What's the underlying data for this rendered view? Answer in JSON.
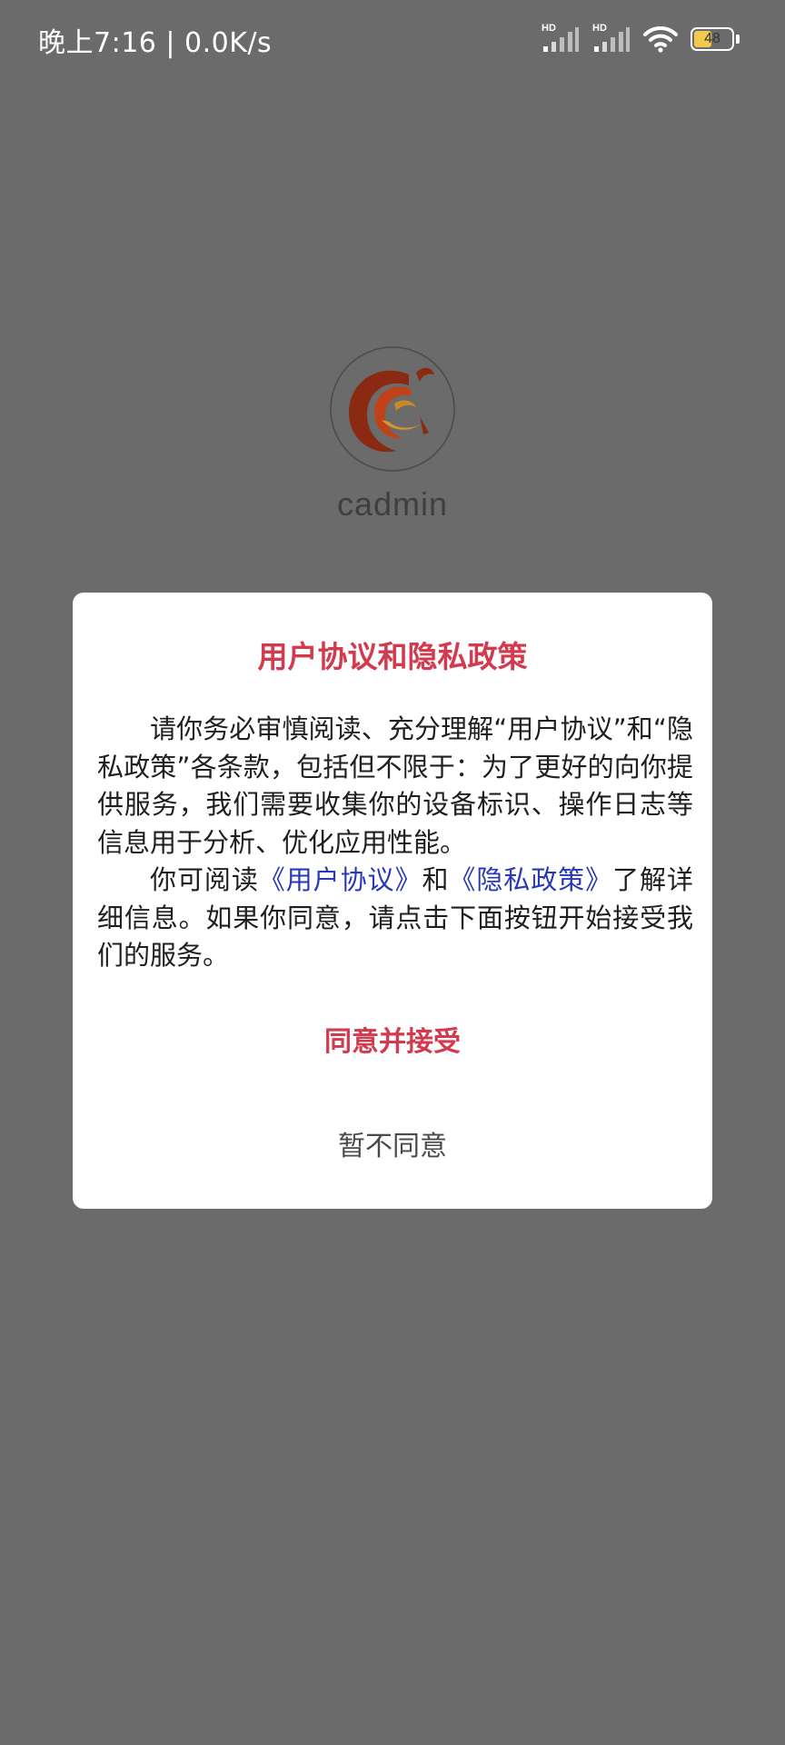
{
  "status_bar": {
    "time": "晚上7:16 | 0.0K/s",
    "sim1_label": "HD",
    "sim2_label": "HD",
    "battery_level": "48",
    "battery_fraction": 0.48,
    "icons": [
      "signal-icon",
      "signal-icon",
      "wifi-icon",
      "battery-icon"
    ]
  },
  "app": {
    "name": "cadmin",
    "logo_icon": "cadmin-logo"
  },
  "dialog": {
    "title": "用户协议和隐私政策",
    "paragraph1": "请你务必审慎阅读、充分理解“用户协议”和“隐私政策”各条款，包括但不限于：为了更好的向你提供服务，我们需要收集你的设备标识、操作日志等信息用于分析、优化应用性能。",
    "p2_prefix": "你可阅读",
    "link_user_agreement": "《用户协议》",
    "p2_and": "和",
    "link_privacy_policy": "《隐私政策》",
    "p2_suffix": "了解详细信息。如果你同意，请点击下面按钮开始接受我们的服务。",
    "agree_label": "同意并接受",
    "decline_label": "暂不同意"
  },
  "colors": {
    "overlay": "#6b6b6b",
    "accent": "#d33a4e",
    "link": "#2738b8",
    "dialog_bg": "#ffffff"
  }
}
